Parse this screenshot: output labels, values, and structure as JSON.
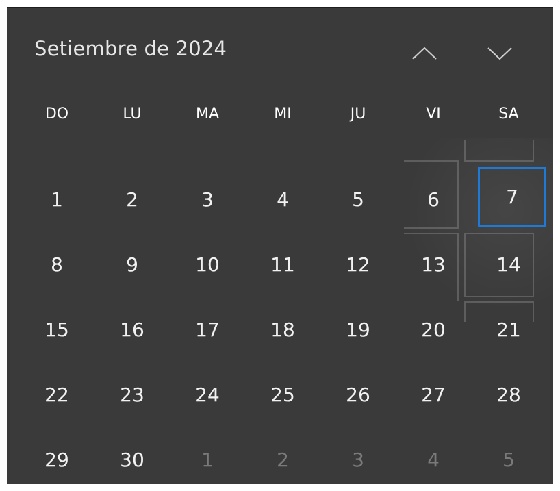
{
  "header": {
    "month_title": "Setiembre de 2024"
  },
  "weekdays": [
    "DO",
    "LU",
    "MA",
    "MI",
    "JU",
    "VI",
    "SA"
  ],
  "days": [
    {
      "label": "1"
    },
    {
      "label": "2"
    },
    {
      "label": "3"
    },
    {
      "label": "4"
    },
    {
      "label": "5"
    },
    {
      "label": "6"
    },
    {
      "label": "7",
      "today": true
    },
    {
      "label": "8"
    },
    {
      "label": "9"
    },
    {
      "label": "10"
    },
    {
      "label": "11"
    },
    {
      "label": "12"
    },
    {
      "label": "13"
    },
    {
      "label": "14"
    },
    {
      "label": "15"
    },
    {
      "label": "16"
    },
    {
      "label": "17"
    },
    {
      "label": "18"
    },
    {
      "label": "19"
    },
    {
      "label": "20"
    },
    {
      "label": "21"
    },
    {
      "label": "22"
    },
    {
      "label": "23"
    },
    {
      "label": "24"
    },
    {
      "label": "25"
    },
    {
      "label": "26"
    },
    {
      "label": "27"
    },
    {
      "label": "28"
    },
    {
      "label": "29"
    },
    {
      "label": "30"
    },
    {
      "label": "1",
      "other": true
    },
    {
      "label": "2",
      "other": true
    },
    {
      "label": "3",
      "other": true
    },
    {
      "label": "4",
      "other": true
    },
    {
      "label": "5",
      "other": true
    }
  ],
  "colors": {
    "background": "#3a3a3a",
    "today_border": "#1e7ad4",
    "other_month_text": "#7a7a7a"
  },
  "icons": {
    "previous": "chevron-up-icon",
    "next": "chevron-down-icon"
  }
}
